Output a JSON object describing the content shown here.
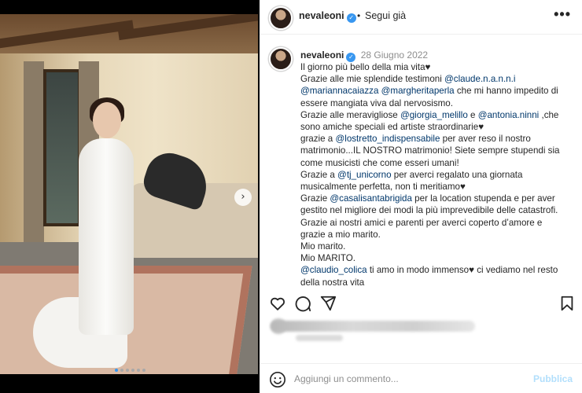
{
  "post": {
    "username": "nevaleoni",
    "follow_separator": "•",
    "follow_label": "Segui già",
    "more_label": "•••",
    "date": "28 Giugno 2022",
    "carousel": {
      "slide_count": 6,
      "active_index": 0
    },
    "caption": [
      {
        "t": "Il giorno più bello della mia vita♥"
      },
      {
        "br": true
      },
      {
        "t": "Grazie alle mie splendide testimoni "
      },
      {
        "m": "@claude.n.a.n.n.i"
      },
      {
        "br": true
      },
      {
        "m": "@mariannacaiazza"
      },
      {
        "t": " "
      },
      {
        "m": "@margheritaperla"
      },
      {
        "t": " che mi hanno impedito di essere mangiata viva dal nervosismo."
      },
      {
        "br": true
      },
      {
        "t": "Grazie alle meravigliose "
      },
      {
        "m": "@giorgia_melillo"
      },
      {
        "t": " e "
      },
      {
        "m": "@antonia.ninni"
      },
      {
        "t": " ,che sono amiche speciali ed artiste straordinarie♥"
      },
      {
        "br": true
      },
      {
        "t": "grazie a "
      },
      {
        "m": "@lostretto_indispensabile"
      },
      {
        "t": " per aver reso il nostro matrimonio...IL NOSTRO matrimonio! Siete sempre stupendi sia come musicisti che come esseri umani!"
      },
      {
        "br": true
      },
      {
        "t": "Grazie a "
      },
      {
        "m": "@tj_unicorno"
      },
      {
        "t": " per averci regalato una giornata musicalmente perfetta, non ti meritiamo♥"
      },
      {
        "br": true
      },
      {
        "t": "Grazie "
      },
      {
        "m": "@casalisantabrigida"
      },
      {
        "t": " per la location stupenda e per aver gestito nel migliore dei modi la più imprevedibile delle catastrofi."
      },
      {
        "br": true
      },
      {
        "t": "Grazie ai nostri amici e parenti per averci coperto d’amore e grazie a mio marito."
      },
      {
        "br": true
      },
      {
        "t": "Mio marito."
      },
      {
        "br": true
      },
      {
        "t": "Mio MARITO."
      },
      {
        "br": true
      },
      {
        "m": "@claudio_colica"
      },
      {
        "t": " ti amo in modo immenso♥ ci vediamo nel resto della nostra vita"
      }
    ]
  },
  "comment": {
    "placeholder": "Aggiungi un commento...",
    "publish_label": "Pubblica"
  },
  "icons": [
    "heart-icon",
    "comment-icon",
    "share-icon",
    "bookmark-icon",
    "emoji-icon",
    "verified-icon",
    "next-arrow-icon",
    "more-icon"
  ],
  "colors": {
    "mention": "#00376b",
    "verified": "#3897f0",
    "publish_disabled": "#b2dffc",
    "date": "#8e8e8e"
  }
}
